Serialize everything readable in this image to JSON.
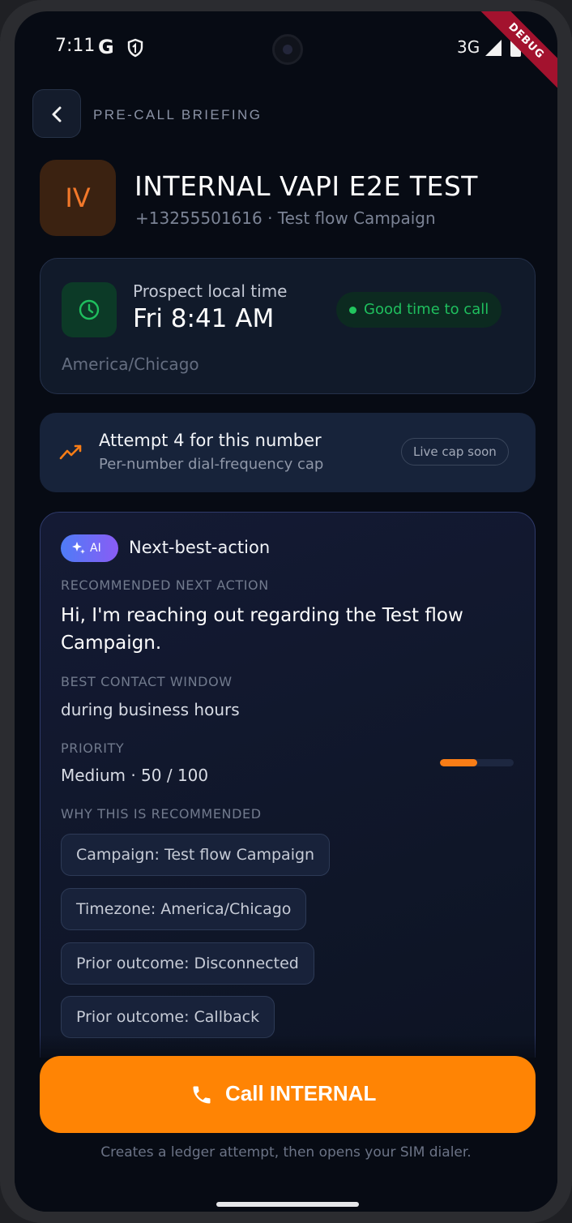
{
  "status_bar": {
    "time": "7:11",
    "g": "G",
    "network": "3G",
    "debug": "DEBUG"
  },
  "header": {
    "title": "PRE-CALL BRIEFING"
  },
  "contact": {
    "initials": "IV",
    "name": "INTERNAL VAPI E2E TEST",
    "subtitle": "+13255501616 · Test flow Campaign"
  },
  "local_time": {
    "label": "Prospect local time",
    "value": "Fri 8:41 AM",
    "status": "Good time to call",
    "timezone": "America/Chicago"
  },
  "attempt": {
    "title": "Attempt 4 for this number",
    "subtitle": "Per-number dial-frequency cap",
    "pill": "Live cap soon"
  },
  "ai_card": {
    "badge": "AI",
    "title": "Next-best-action",
    "recommended_label": "RECOMMENDED NEXT ACTION",
    "recommended_text": "Hi, I'm reaching out regarding the Test flow Campaign.",
    "window_label": "BEST CONTACT WINDOW",
    "window_text": "during business hours",
    "priority_label": "PRIORITY",
    "priority_text": "Medium · 50 / 100",
    "priority_value": 50,
    "priority_max": 100,
    "why_label": "WHY THIS IS RECOMMENDED",
    "reasons": [
      "Campaign: Test flow Campaign",
      "Timezone: America/Chicago",
      "Prior outcome: Disconnected",
      "Prior outcome: Callback"
    ]
  },
  "call_button": {
    "label": "Call INTERNAL"
  },
  "footer_note": "Creates a ledger attempt, then opens your SIM dialer.",
  "colors": {
    "accent": "#ff8404",
    "good": "#22c55e",
    "background": "#070b14"
  }
}
